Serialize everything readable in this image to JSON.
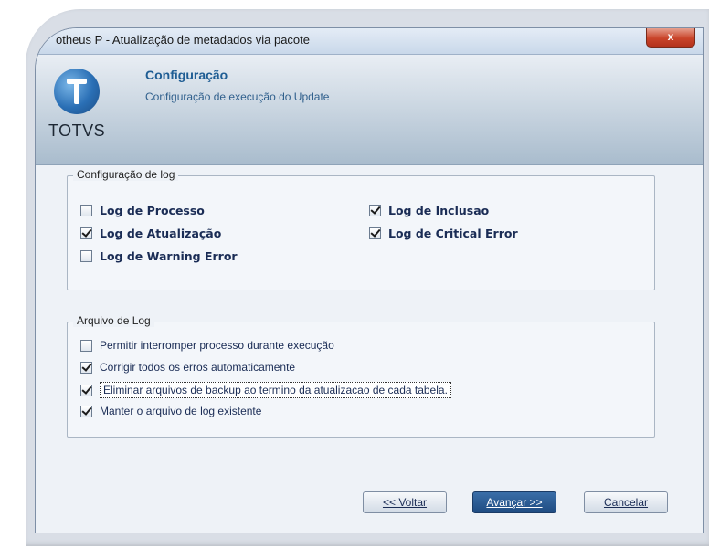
{
  "window": {
    "title": "otheus P - Atualização de metadados via pacote",
    "close_label": "x"
  },
  "header": {
    "brand": "TOTVS",
    "title": "Configuração",
    "subtitle": "Configuração de execução do Update"
  },
  "log_config": {
    "legend": "Configuração de log",
    "items": [
      {
        "label": "Log de Processo",
        "checked": false
      },
      {
        "label": "Log de Atualização",
        "checked": true
      },
      {
        "label": "Log de Warning Error",
        "checked": false
      },
      {
        "label": "Log de Inclusao",
        "checked": true
      },
      {
        "label": "Log de Critical Error",
        "checked": true
      }
    ]
  },
  "log_file": {
    "legend": "Arquivo de Log",
    "items": [
      {
        "label": "Permitir interromper processo durante execução",
        "checked": false
      },
      {
        "label": "Corrigir todos os erros automaticamente",
        "checked": true
      },
      {
        "label": "Eliminar arquivos de backup ao termino da atualizacao de cada tabela.",
        "checked": true
      },
      {
        "label": "Manter o arquivo de log existente",
        "checked": true
      }
    ]
  },
  "buttons": {
    "back": "<< Voltar",
    "next": "Avançar >>",
    "cancel": "Cancelar"
  }
}
